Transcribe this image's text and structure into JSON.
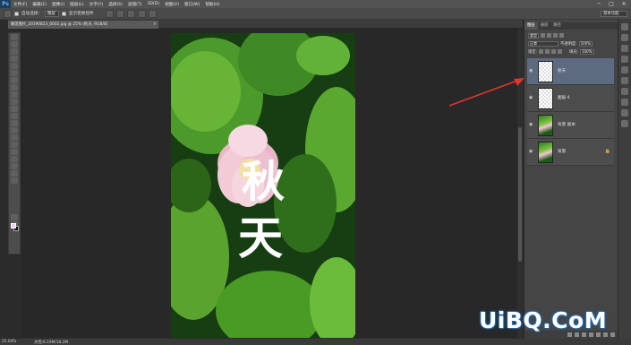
{
  "menubar": {
    "logo": "Ps",
    "items": [
      "文件(F)",
      "编辑(E)",
      "图像(I)",
      "图层(L)",
      "文字(Y)",
      "选择(S)",
      "滤镜(T)",
      "3D(D)",
      "视图(V)",
      "窗口(W)",
      "帮助(H)"
    ]
  },
  "window_controls": {
    "minimize": "─",
    "maximize": "□",
    "close": "✕"
  },
  "options": {
    "auto_select_label": "自动选择：",
    "auto_select_value": "图层",
    "transform_label": "显示变换控件",
    "workspace": "基本功能"
  },
  "document_tab": {
    "title": "睡莲图片_20190823_0002.jpg @ 25% (秋天, RGB/8)",
    "close": "×"
  },
  "status": {
    "zoom": "25.04%",
    "doc_size": "文档:6.19M/18.2M"
  },
  "panel": {
    "tabs": [
      "图层",
      "通道",
      "路径"
    ],
    "kind_filter": "类型",
    "blend_mode": "正常",
    "opacity_label": "不透明度:",
    "opacity_value": "100%",
    "lock_label": "锁定:",
    "fill_label": "填充:",
    "fill_value": "100%"
  },
  "layers": [
    {
      "name": "秋天",
      "thumb": "transparent",
      "visible": true,
      "selected": true
    },
    {
      "name": "图层 4",
      "thumb": "transparent",
      "visible": true,
      "selected": false
    },
    {
      "name": "背景 副本",
      "thumb": "photo",
      "visible": true,
      "selected": false
    },
    {
      "name": "背景",
      "thumb": "photo",
      "visible": true,
      "selected": false,
      "locked": true
    }
  ],
  "canvas": {
    "text_line1": "秋",
    "text_line2": "天"
  },
  "watermark": "UiBQ.CoM",
  "colors": {
    "accent_arrow": "#e0352b",
    "selected_layer": "#5d6b80",
    "foreground": "#f4d0ea",
    "background": "#111111"
  }
}
